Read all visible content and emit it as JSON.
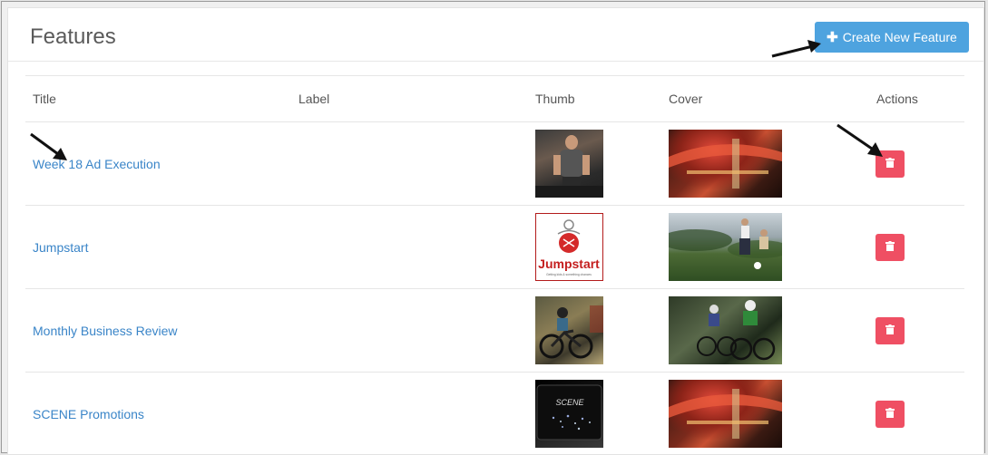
{
  "header": {
    "title": "Features",
    "create_button_label": "Create New Feature",
    "create_button_icon": "plus-icon"
  },
  "table": {
    "columns": [
      "Title",
      "Label",
      "Thumb",
      "Cover",
      "Actions"
    ],
    "rows": [
      {
        "title": "Week 18 Ad Execution",
        "label": ""
      },
      {
        "title": "Jumpstart",
        "label": ""
      },
      {
        "title": "Monthly Business Review",
        "label": ""
      },
      {
        "title": "SCENE Promotions",
        "label": ""
      }
    ],
    "jumpstart_logo_text": "Jumpstart",
    "jumpstart_tagline": "Getting kids & something chances",
    "scene_card_text": "SCENE"
  },
  "colors": {
    "primary": "#4ea3df",
    "link": "#3a85c8",
    "danger": "#ef4f63"
  }
}
